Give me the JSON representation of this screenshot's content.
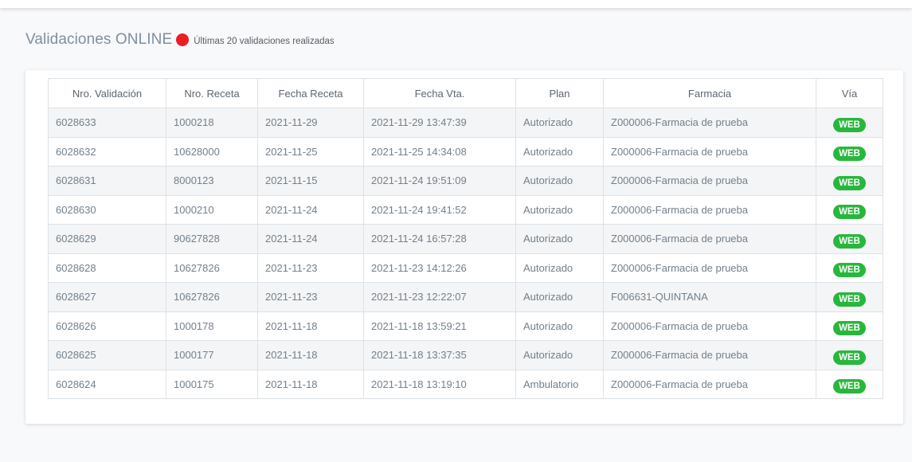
{
  "header": {
    "title": "Validaciones ONLINE",
    "indicator_color": "#ee1c25",
    "subtitle": "Últimas 20 validaciones realizadas"
  },
  "table": {
    "columns": [
      "Nro. Validación",
      "Nro. Receta",
      "Fecha Receta",
      "Fecha Vta.",
      "Plan",
      "Farmacia",
      "Vía"
    ],
    "rows": [
      {
        "validacion": "6028633",
        "receta": "1000218",
        "fecha_receta": "2021-11-29",
        "fecha_vta": "2021-11-29 13:47:39",
        "plan": "Autorizado",
        "farmacia": "Z000006-Farmacia de prueba",
        "via": "WEB"
      },
      {
        "validacion": "6028632",
        "receta": "10628000",
        "fecha_receta": "2021-11-25",
        "fecha_vta": "2021-11-25 14:34:08",
        "plan": "Autorizado",
        "farmacia": "Z000006-Farmacia de prueba",
        "via": "WEB"
      },
      {
        "validacion": "6028631",
        "receta": "8000123",
        "fecha_receta": "2021-11-15",
        "fecha_vta": "2021-11-24 19:51:09",
        "plan": "Autorizado",
        "farmacia": "Z000006-Farmacia de prueba",
        "via": "WEB"
      },
      {
        "validacion": "6028630",
        "receta": "1000210",
        "fecha_receta": "2021-11-24",
        "fecha_vta": "2021-11-24 19:41:52",
        "plan": "Autorizado",
        "farmacia": "Z000006-Farmacia de prueba",
        "via": "WEB"
      },
      {
        "validacion": "6028629",
        "receta": "90627828",
        "fecha_receta": "2021-11-24",
        "fecha_vta": "2021-11-24 16:57:28",
        "plan": "Autorizado",
        "farmacia": "Z000006-Farmacia de prueba",
        "via": "WEB"
      },
      {
        "validacion": "6028628",
        "receta": "10627826",
        "fecha_receta": "2021-11-23",
        "fecha_vta": "2021-11-23 14:12:26",
        "plan": "Autorizado",
        "farmacia": "Z000006-Farmacia de prueba",
        "via": "WEB"
      },
      {
        "validacion": "6028627",
        "receta": "10627826",
        "fecha_receta": "2021-11-23",
        "fecha_vta": "2021-11-23 12:22:07",
        "plan": "Autorizado",
        "farmacia": "F006631-QUINTANA",
        "via": "WEB"
      },
      {
        "validacion": "6028626",
        "receta": "1000178",
        "fecha_receta": "2021-11-18",
        "fecha_vta": "2021-11-18 13:59:21",
        "plan": "Autorizado",
        "farmacia": "Z000006-Farmacia de prueba",
        "via": "WEB"
      },
      {
        "validacion": "6028625",
        "receta": "1000177",
        "fecha_receta": "2021-11-18",
        "fecha_vta": "2021-11-18 13:37:35",
        "plan": "Autorizado",
        "farmacia": "Z000006-Farmacia de prueba",
        "via": "WEB"
      },
      {
        "validacion": "6028624",
        "receta": "1000175",
        "fecha_receta": "2021-11-18",
        "fecha_vta": "2021-11-18 13:19:10",
        "plan": "Ambulatorio",
        "farmacia": "Z000006-Farmacia de prueba",
        "via": "WEB"
      }
    ]
  },
  "colors": {
    "web_badge": "#28b73c"
  }
}
